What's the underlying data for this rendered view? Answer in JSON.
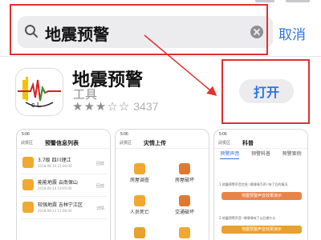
{
  "search": {
    "query": "地震预警",
    "cancel_label": "取消"
  },
  "app": {
    "name": "地震预警",
    "category": "工具",
    "rating": 3.5,
    "rating_count": "3437",
    "open_label": "打开",
    "icon_letters": "c L"
  },
  "colors": {
    "accent": "#2f73e0",
    "annotation_red": "#e03030",
    "list_icon": "#f0a830"
  },
  "screenshots": [
    {
      "status_time": "5:06",
      "location": "武侯区",
      "title": "预警信息列表",
      "items": [
        {
          "title": "3.7级  四川理江",
          "sub": "2018-08-14 21:00:00",
          "tag": "回放"
        },
        {
          "title": "能能地震  云南保山",
          "sub": "2018-08-14 19:05:00",
          "tag": "回放"
        },
        {
          "title": "较强地震  吉林宁江区",
          "sub": "2018-08-13 11:06:00",
          "tag": "详情"
        }
      ]
    },
    {
      "status_time": "5:06",
      "location": "武侯区",
      "title": "灾情上传",
      "cells": [
        {
          "label": "房屋调查",
          "color": "#f0a830"
        },
        {
          "label": "房屋破坏",
          "color": "#e07a30"
        },
        {
          "label": "人员死亡",
          "color": "#f0a830"
        },
        {
          "label": "交通破坏",
          "color": "#e07a30"
        }
      ]
    },
    {
      "status_time": "5:06",
      "location": "武侯区",
      "title": "科普",
      "tabs": [
        "预警声音",
        "预警科普",
        "预警案例"
      ],
      "lines": [
        "1.地震预警声音信息: 嘀嘀嘀(5声) 响了后的情况",
        "2.地震预警声音: 嘀嘀嘀响了以后做什么"
      ],
      "bars": [
        {
          "label": "地震预警声音效果演示",
          "color": "#e8844a"
        },
        {
          "label": "地震预警声音效果演示",
          "color": "#e8a030"
        }
      ]
    }
  ]
}
